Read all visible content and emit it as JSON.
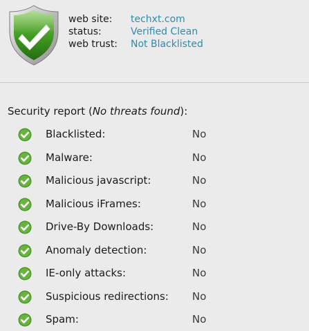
{
  "site_info": {
    "website_label": "web site:",
    "website_value": "techxt.com",
    "status_label": "status:",
    "status_value": "Verified Clean",
    "trust_label": "web trust:",
    "trust_value": "Not Blacklisted"
  },
  "report": {
    "title_prefix": "Security report (",
    "title_emphasis": "No threats found",
    "title_suffix": "):",
    "items": [
      {
        "label": "Blacklisted:",
        "value": "No"
      },
      {
        "label": "Malware:",
        "value": "No"
      },
      {
        "label": "Malicious javascript:",
        "value": "No"
      },
      {
        "label": "Malicious iFrames:",
        "value": "No"
      },
      {
        "label": "Drive-By Downloads:",
        "value": "No"
      },
      {
        "label": "Anomaly detection:",
        "value": "No"
      },
      {
        "label": "IE-only attacks:",
        "value": "No"
      },
      {
        "label": "Suspicious redirections:",
        "value": "No"
      },
      {
        "label": "Spam:",
        "value": "No"
      }
    ]
  },
  "icons": {
    "shield": "shield-check-icon",
    "check": "check-circle-icon"
  },
  "colors": {
    "background": "#ebebeb",
    "link": "#2e8bb0",
    "green": "#4a9a2a",
    "divider": "#c8c8c8"
  }
}
